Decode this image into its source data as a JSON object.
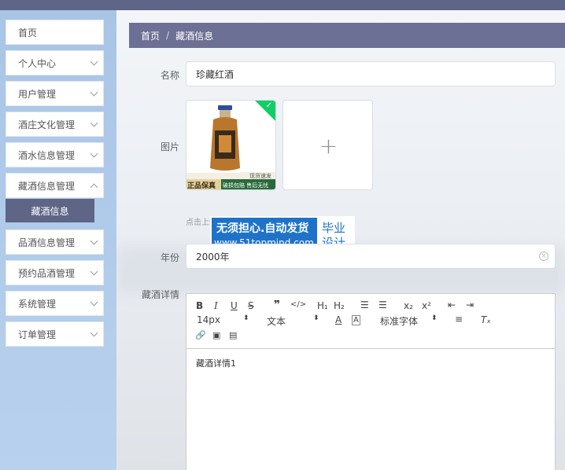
{
  "sidebar": {
    "items": [
      {
        "label": "首页",
        "chevron": false
      },
      {
        "label": "个人中心",
        "chevron": true
      },
      {
        "label": "用户管理",
        "chevron": true
      },
      {
        "label": "酒庄文化管理",
        "chevron": true
      },
      {
        "label": "酒水信息管理",
        "chevron": true
      },
      {
        "label": "藏酒信息管理",
        "chevron": true
      },
      {
        "label": "品酒信息管理",
        "chevron": true
      },
      {
        "label": "预约品酒管理",
        "chevron": true
      },
      {
        "label": "系统管理",
        "chevron": true
      },
      {
        "label": "订单管理",
        "chevron": true
      }
    ],
    "active_sub": "藏酒信息"
  },
  "breadcrumb": {
    "home": "首页",
    "sep": "/",
    "current": "藏酒信息"
  },
  "form": {
    "name_label": "名称",
    "name_value": "珍藏红酒",
    "image_label": "图片",
    "upload_hint": "点击上传图片",
    "year_label": "年份",
    "year_value": "2000年",
    "detail_label": "藏酒详情"
  },
  "product_image": {
    "badge_left": "正品保真",
    "badge_right1": "现货速发",
    "badge_right2": "破损包赔 售后无忧"
  },
  "watermark": {
    "line1": "无须担心.自动发货",
    "line2": "www.51topmind.com",
    "right1": "毕业",
    "right2": "设计"
  },
  "editor": {
    "font_size": "14px",
    "font_type": "文本",
    "font_family": "标准字体",
    "content": "藏酒详情1"
  },
  "colors": {
    "accent": "#6c7094",
    "sidebar": "#a9c5e6",
    "success": "#13ce66",
    "watermark": "#1e73c9"
  }
}
